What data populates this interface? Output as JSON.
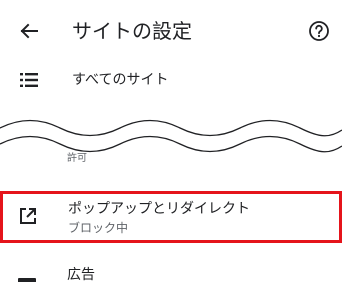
{
  "appbar": {
    "title": "サイトの設定",
    "back_icon": "arrow-back-icon",
    "help_icon": "help-circle-icon"
  },
  "all_sites": {
    "label": "すべてのサイト",
    "icon": "list-icon"
  },
  "section": {
    "label": "許可"
  },
  "popups": {
    "title": "ポップアップとリダイレクト",
    "status": "ブロック中",
    "icon": "open-in-new-icon",
    "highlight_color": "#e5141b"
  },
  "ads": {
    "label": "広告",
    "icon": "ads-icon"
  },
  "colors": {
    "text_primary": "#202124",
    "text_secondary": "#5f6368",
    "background": "#ffffff"
  }
}
